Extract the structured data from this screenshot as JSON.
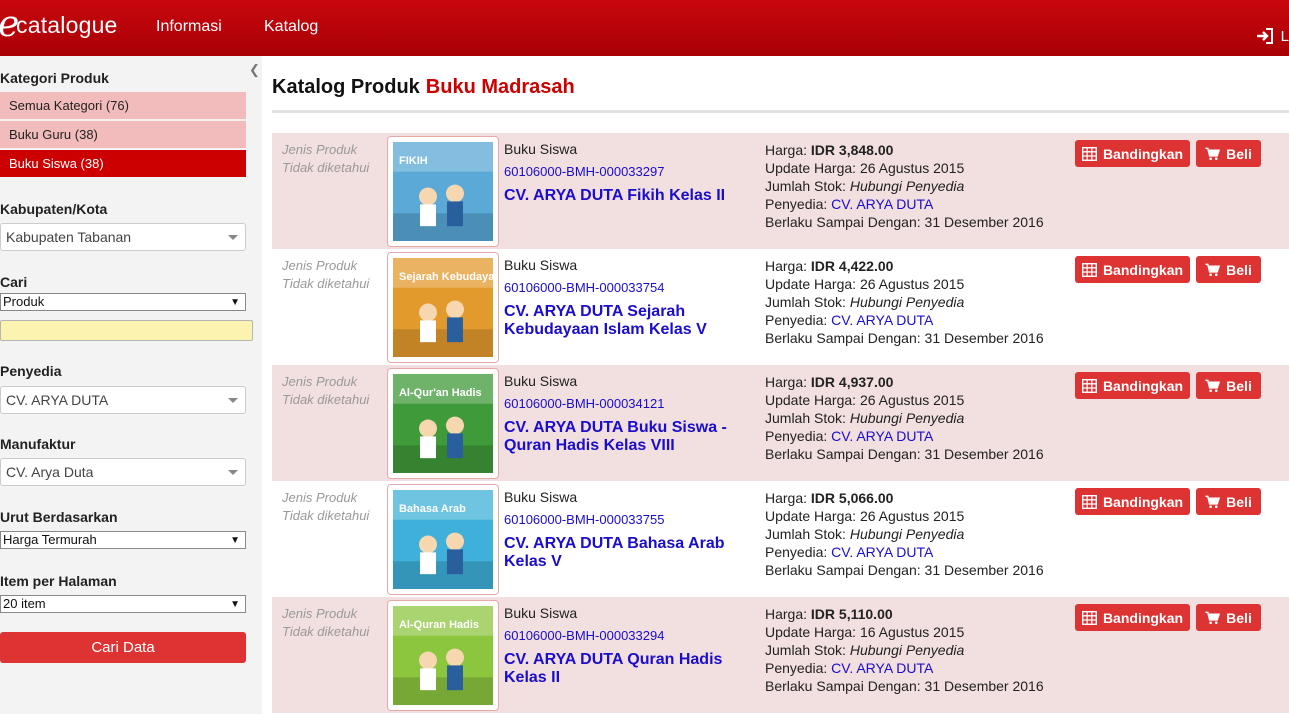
{
  "header": {
    "logo_e": "e",
    "logo_rest": "catalogue",
    "nav": [
      "Informasi",
      "Katalog"
    ],
    "login_label": "L"
  },
  "sidebar": {
    "kategori_title": "Kategori Produk",
    "categories": [
      {
        "label": "Semua Kategori (76)",
        "active": false
      },
      {
        "label": "Buku Guru (38)",
        "active": false
      },
      {
        "label": "Buku Siswa (38)",
        "active": true
      }
    ],
    "kabupaten_title": "Kabupaten/Kota",
    "kabupaten_value": "Kabupaten Tabanan",
    "cari_title": "Cari",
    "cari_type": "Produk",
    "cari_value": "",
    "penyedia_title": "Penyedia",
    "penyedia_value": "CV. ARYA DUTA",
    "manufaktur_title": "Manufaktur",
    "manufaktur_value": "CV. Arya Duta",
    "urut_title": "Urut Berdasarkan",
    "urut_value": "Harga Termurah",
    "item_title": "Item per Halaman",
    "item_value": "20 item",
    "button_label": "Cari Data"
  },
  "main": {
    "title": "Katalog Produk",
    "subtitle": "Buku Madrasah",
    "labels": {
      "jenis1": "Jenis Produk",
      "jenis2": "Tidak diketahui",
      "harga": "Harga:",
      "update": "Update Harga:",
      "stok": "Jumlah Stok:",
      "penyedia": "Penyedia:",
      "berlaku": "Berlaku Sampai Dengan:",
      "compare": "Bandingkan",
      "buy": "Beli"
    },
    "products": [
      {
        "kategori": "Buku Siswa",
        "code": "60106000-BMH-000033297",
        "name": "CV. ARYA DUTA Fikih Kelas II",
        "price": "IDR 3,848.00",
        "update": "26 Agustus 2015",
        "stok": "Hubungi Penyedia",
        "penyedia": "CV. ARYA DUTA",
        "berlaku": "31 Desember 2016",
        "cover_title": "FIKIH",
        "cover_color": "#5aa9d6"
      },
      {
        "kategori": "Buku Siswa",
        "code": "60106000-BMH-000033754",
        "name": "CV. ARYA DUTA Sejarah Kebudayaan Islam Kelas V",
        "price": "IDR 4,422.00",
        "update": "26 Agustus 2015",
        "stok": "Hubungi Penyedia",
        "penyedia": "CV. ARYA DUTA",
        "berlaku": "31 Desember 2016",
        "cover_title": "Sejarah Kebudayaan Islam",
        "cover_color": "#e39a2d"
      },
      {
        "kategori": "Buku Siswa",
        "code": "60106000-BMH-000034121",
        "name": "CV. ARYA DUTA Buku Siswa - Quran Hadis Kelas VIII",
        "price": "IDR 4,937.00",
        "update": "26 Agustus 2015",
        "stok": "Hubungi Penyedia",
        "penyedia": "CV. ARYA DUTA",
        "berlaku": "31 Desember 2016",
        "cover_title": "Al-Qur'an Hadis",
        "cover_color": "#3f9a3a"
      },
      {
        "kategori": "Buku Siswa",
        "code": "60106000-BMH-000033755",
        "name": "CV. ARYA DUTA Bahasa Arab Kelas V",
        "price": "IDR 5,066.00",
        "update": "26 Agustus 2015",
        "stok": "Hubungi Penyedia",
        "penyedia": "CV. ARYA DUTA",
        "berlaku": "31 Desember 2016",
        "cover_title": "Bahasa Arab",
        "cover_color": "#3fb0d9"
      },
      {
        "kategori": "Buku Siswa",
        "code": "60106000-BMH-000033294",
        "name": "CV. ARYA DUTA Quran Hadis Kelas II",
        "price": "IDR 5,110.00",
        "update": "16 Agustus 2015",
        "stok": "Hubungi Penyedia",
        "penyedia": "CV. ARYA DUTA",
        "berlaku": "31 Desember 2016",
        "cover_title": "Al-Quran Hadis",
        "cover_color": "#8cc63f"
      }
    ]
  }
}
